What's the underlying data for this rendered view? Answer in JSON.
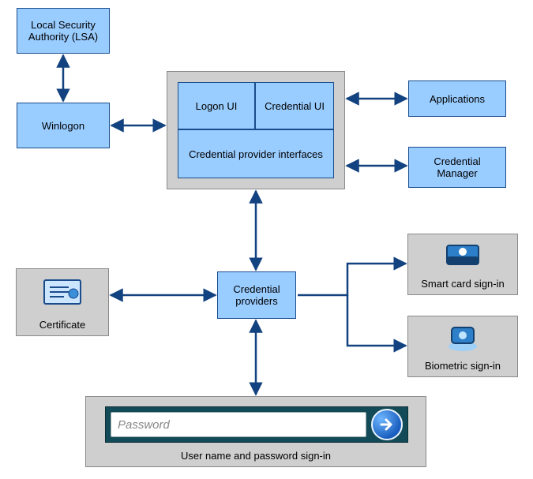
{
  "boxes": {
    "lsa": "Local Security Authority (LSA)",
    "winlogon": "Winlogon",
    "logon_ui": "Logon UI",
    "credential_ui": "Credential UI",
    "cp_interfaces": "Credential provider interfaces",
    "applications": "Applications",
    "cred_manager": "Credential Manager",
    "cred_providers": "Credential providers",
    "certificate": "Certificate",
    "smartcard": "Smart card sign-in",
    "biometric": "Biometric sign-in",
    "userpass": "User name and password sign-in"
  },
  "password_placeholder": "Password"
}
